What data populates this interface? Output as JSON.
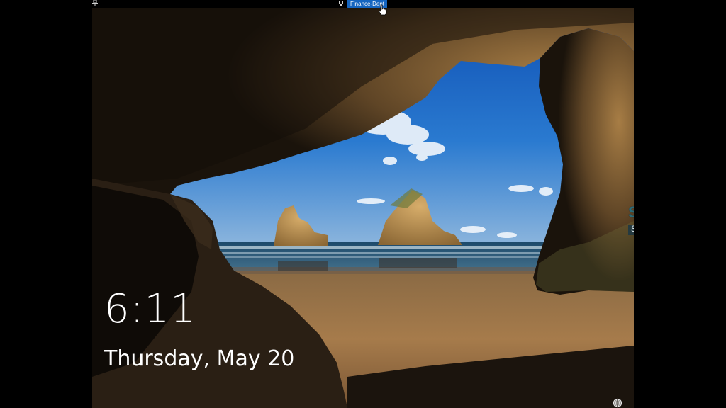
{
  "remote_session": {
    "connection_name": "Finance-Dept",
    "pin_icon": "pin-icon",
    "remote_icon": "remote-desktop-icon"
  },
  "lock_screen": {
    "time": "6:11",
    "date": "Thursday, May 20",
    "network_icon": "network-globe-icon",
    "wallpaper": "sea-cave-beach"
  },
  "watermark": {
    "brand": "SECURIUM",
    "tagline": "SOLUTIONS",
    "colors": {
      "brand": "#2a6b78",
      "tagline_bg": "#253a40",
      "tagline_text": "#e9f1f2"
    }
  },
  "colors": {
    "connection_tab": "#1565c0",
    "text": "#ffffff",
    "background": "#000000"
  }
}
